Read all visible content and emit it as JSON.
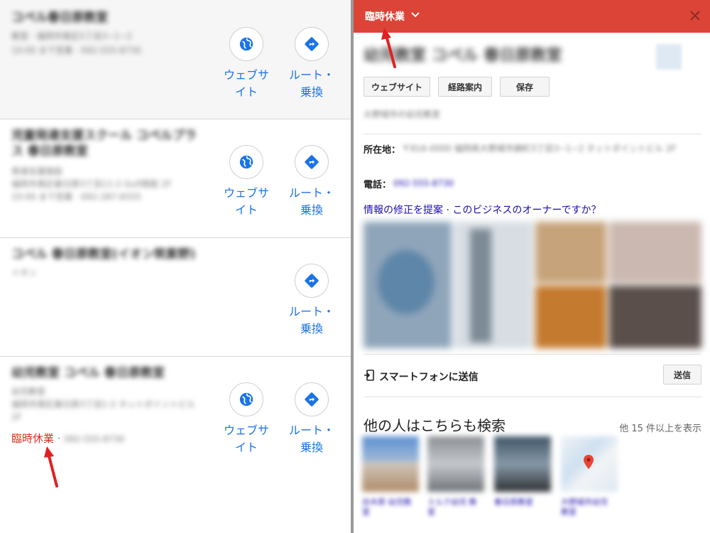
{
  "results": [
    {
      "title": "コペル春日原教室",
      "lines": [
        "教室 · 福岡市南区5丁目3−1−2",
        "10:00 まで営業 · 092-555-8730"
      ],
      "actions": [
        "website",
        "route"
      ]
    },
    {
      "title": "児童発達支援スクール コペルプラス 春日原教室",
      "lines": [
        "発達支援施設",
        "福岡市南区春日原3丁目11-2 Gulf南館 2F",
        "10:00 まで営業 · 092-287-6555"
      ],
      "actions": [
        "website",
        "route"
      ]
    },
    {
      "title": "コペル 春日原教室(イオン筑紫野)",
      "lines": [
        "イオン"
      ],
      "actions": [
        "route"
      ]
    },
    {
      "title": "幼児教室 コペル 春日原教室",
      "lines": [
        "幼児教室",
        "福岡市南区春日原3丁目1-2 ネットポイントビル",
        "2F"
      ],
      "status": "臨時休業",
      "status_sep": "·",
      "status_phone": "092-555-8730",
      "actions": [
        "website",
        "route"
      ]
    }
  ],
  "labels": {
    "website_line1": "ウェブサ",
    "website_line2": "イト",
    "route_line1": "ルート・",
    "route_line2": "乗換"
  },
  "panel": {
    "status_label": "臨時休業",
    "business_name": "幼児教室 コペル 春日原教室",
    "buttons": {
      "website": "ウェブサイト",
      "directions": "経路案内",
      "save": "保存"
    },
    "category": "大野城市の幼児教室",
    "address_key": "所在地：",
    "address_value": "〒816-0000 福岡県大野城市錦町3丁目3−1−2 ネットポイントビル 2F",
    "phone_key": "電話：",
    "phone_value": "092-555-8730",
    "edit_links": "情報の修正を提案 · このビジネスのオーナーですか？",
    "send_to_phone": "スマートフォンに送信",
    "send_button": "送信",
    "others_title": "他の人はこちらも検索",
    "others_more": "他 15 件以上を表示",
    "others": [
      {
        "caption": "白木原 幼児教室"
      },
      {
        "caption": "ミルク幼児 教室"
      },
      {
        "caption": "春日原教室"
      },
      {
        "caption": "大野城市幼児 教室"
      }
    ]
  },
  "colors": {
    "topbar": "#db4437",
    "closed_red": "#d93025",
    "link_blue": "#1a73e8",
    "annotation_red": "#e02020"
  },
  "icons": {
    "website": "globe-icon",
    "route": "directions-icon",
    "status_menu": "chevron-down-icon",
    "close": "close-icon",
    "send": "send-to-phone-icon"
  }
}
